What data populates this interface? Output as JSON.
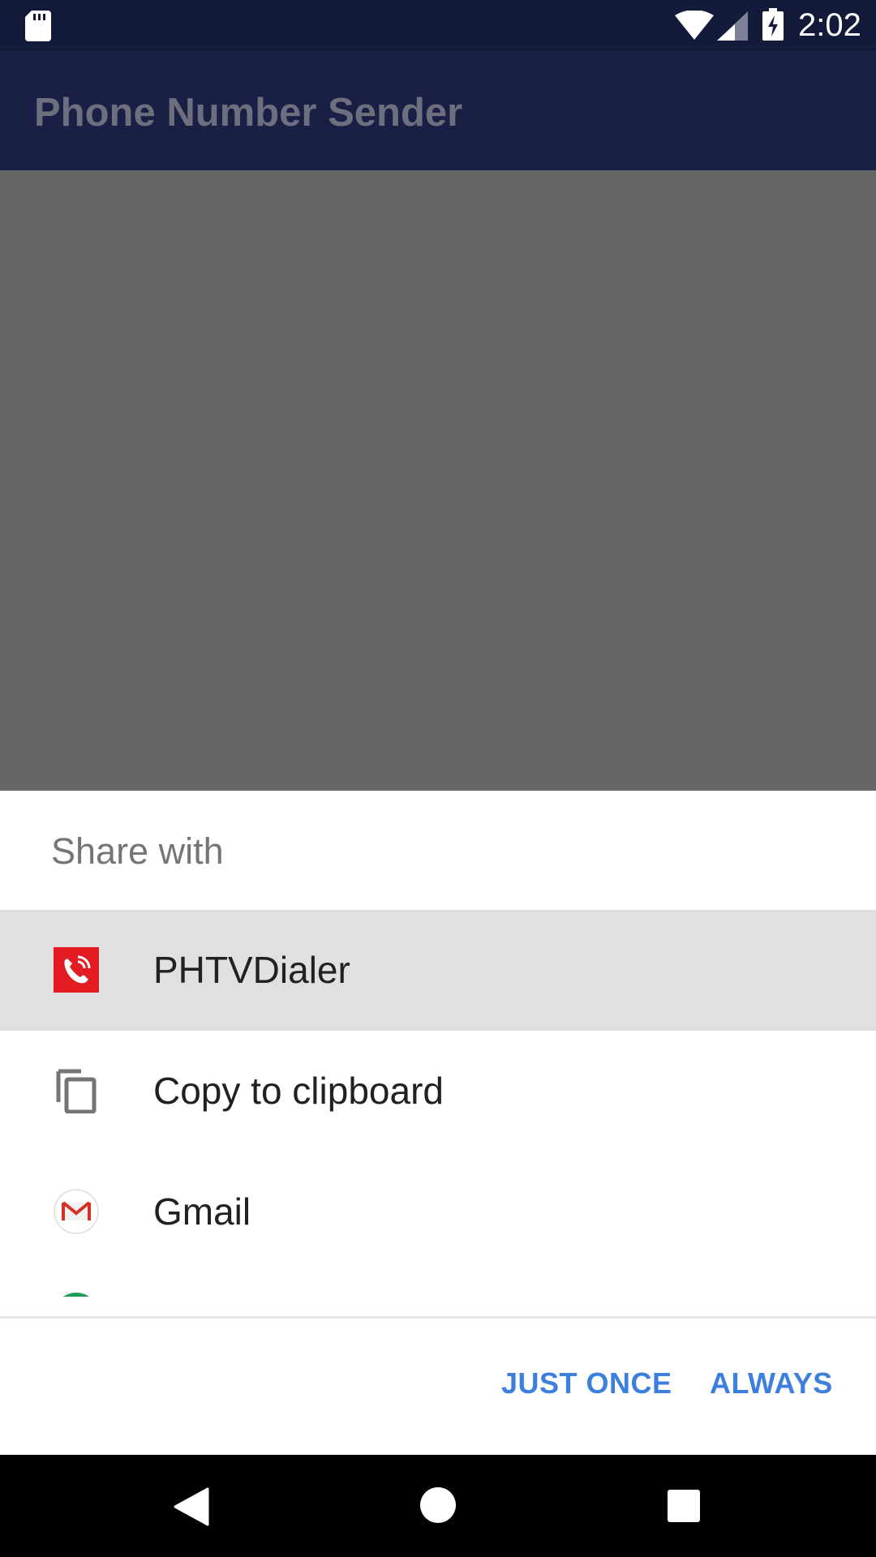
{
  "status_bar": {
    "time": "2:02",
    "icons": [
      "sd-card-icon",
      "wifi-icon",
      "cell-signal-icon",
      "battery-charging-icon"
    ]
  },
  "app_bar": {
    "title": "Phone Number Sender"
  },
  "share_sheet": {
    "title": "Share with",
    "items": [
      {
        "label": "PHTVDialer",
        "icon": "phtvdialer-app-icon",
        "selected": true
      },
      {
        "label": "Copy to clipboard",
        "icon": "copy-icon",
        "selected": false
      },
      {
        "label": "Gmail",
        "icon": "gmail-icon",
        "selected": false
      }
    ],
    "buttons": {
      "just_once": "JUST ONCE",
      "always": "ALWAYS"
    }
  },
  "nav_bar": {
    "icons": [
      "back-icon",
      "home-icon",
      "recents-icon"
    ]
  },
  "colors": {
    "status_bar": "#141a3a",
    "app_bar": "#1a1f45",
    "scrim": "#666666",
    "accent": "#3c7fdc",
    "selected_row": "#e0e0e0"
  }
}
